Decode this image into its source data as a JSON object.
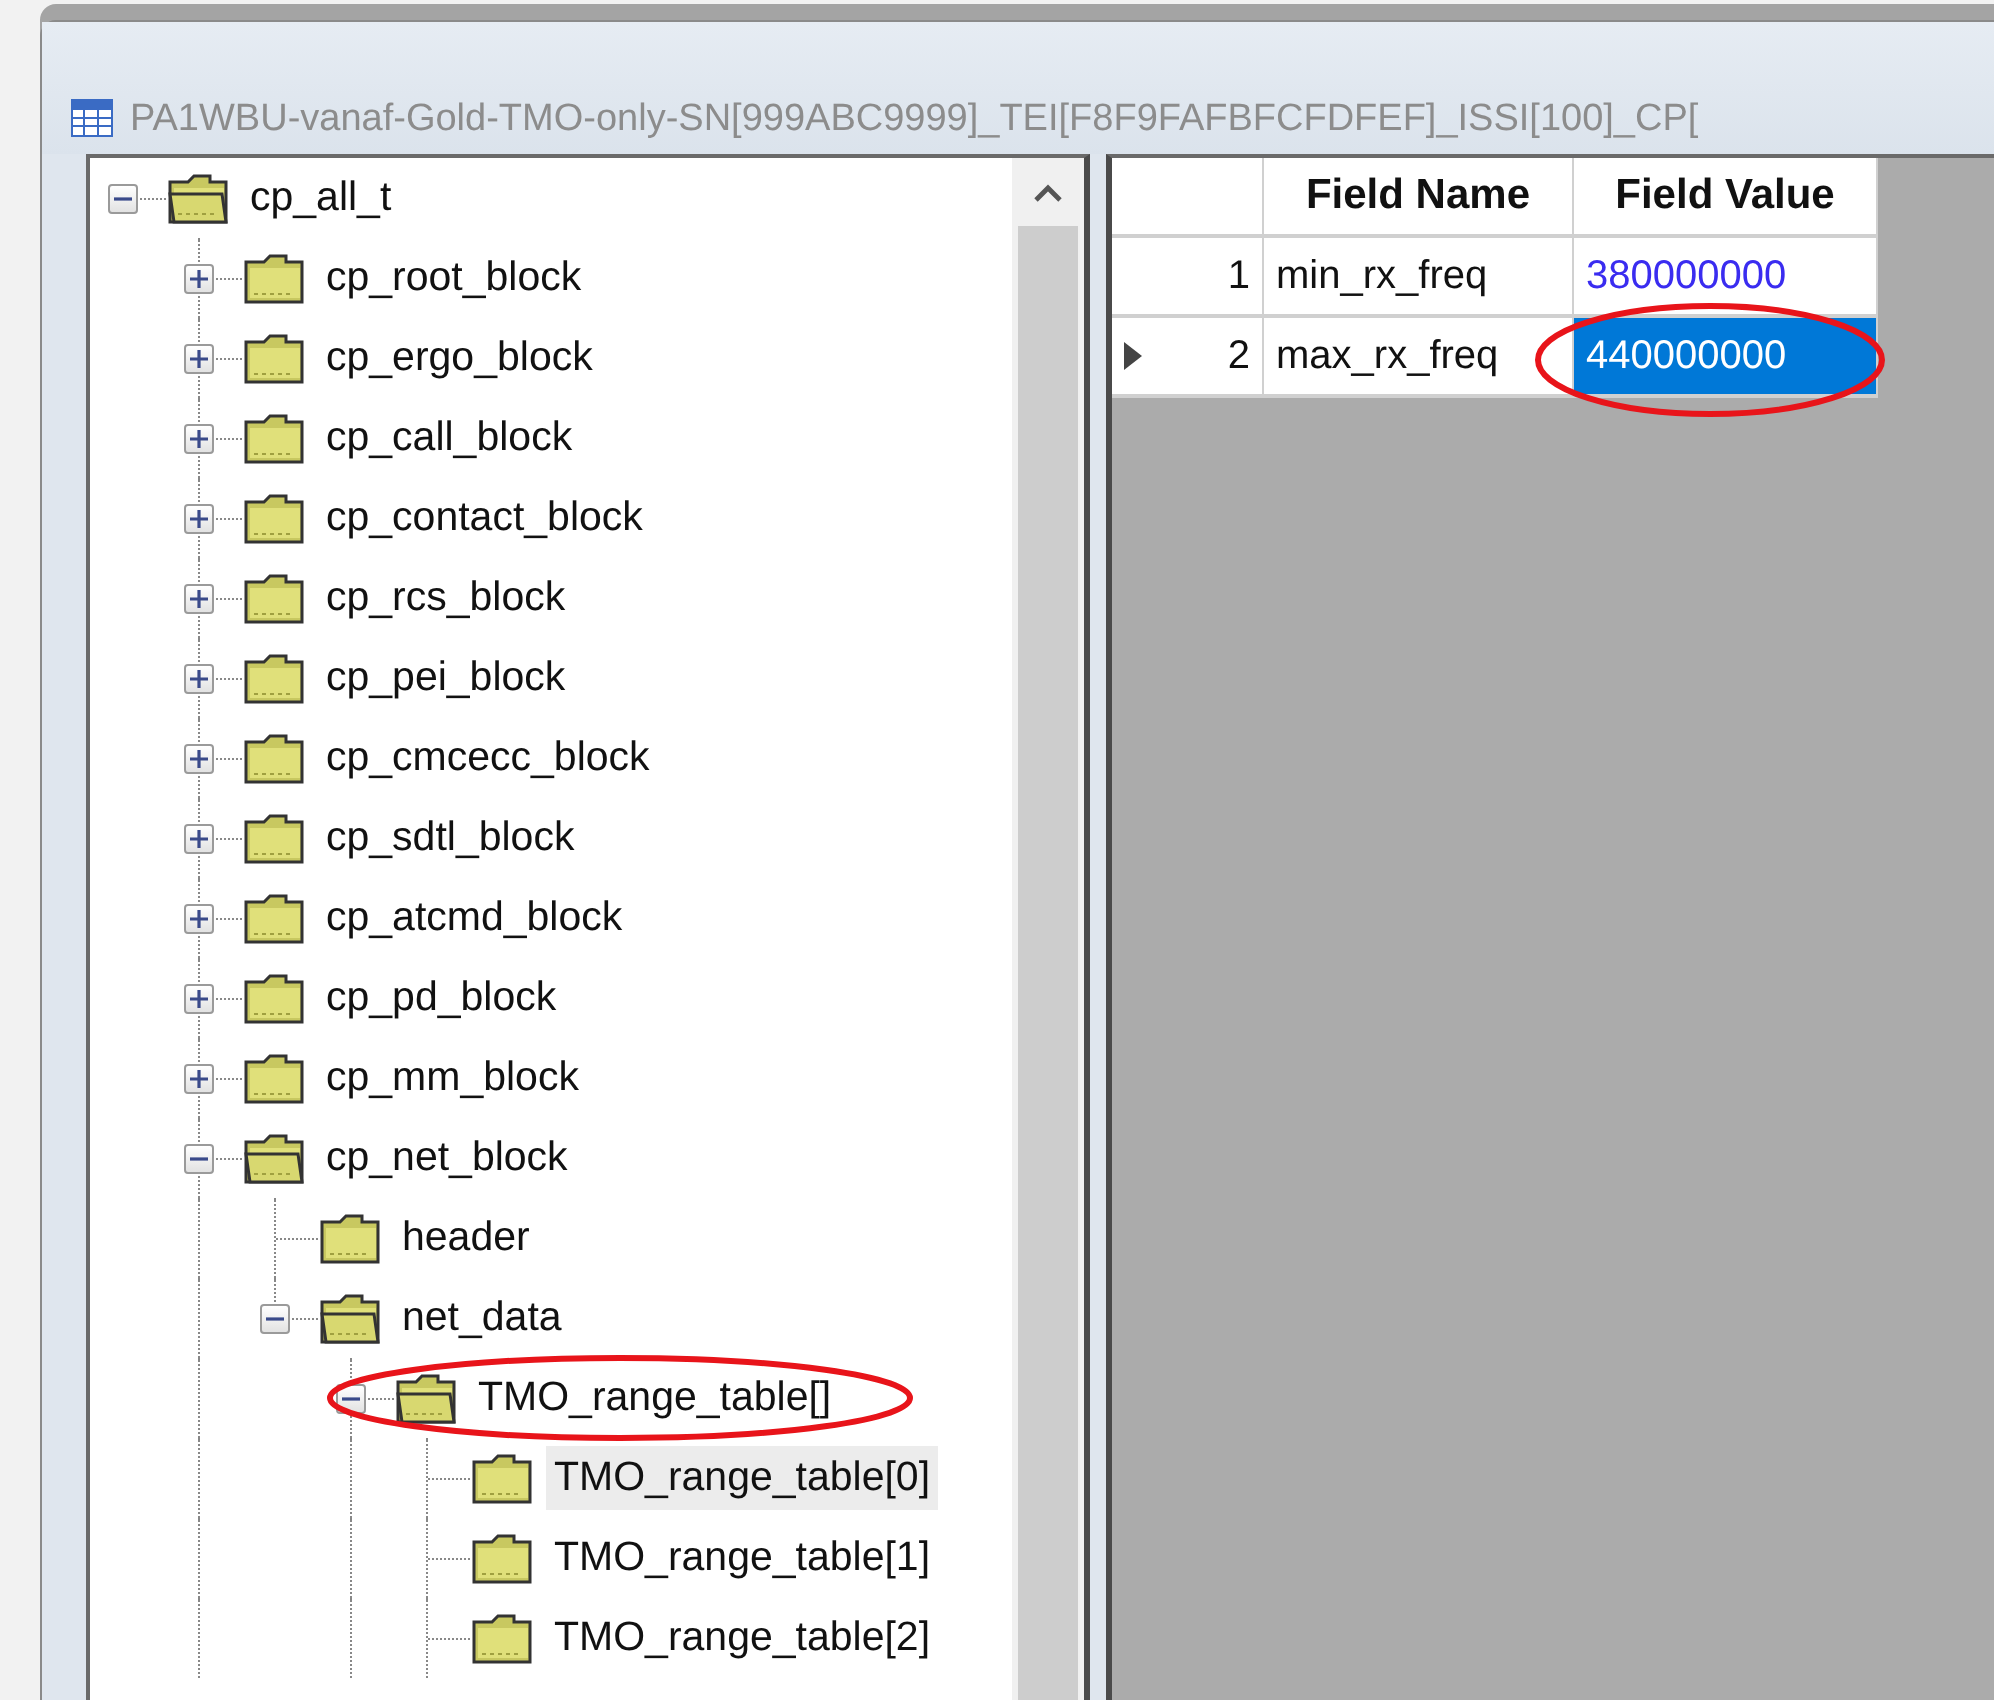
{
  "window": {
    "title": "PA1WBU-vanaf-Gold-TMO-only-SN[999ABC9999]_TEI[F8F9FAFBFCFDFEF]_ISSI[100]_CP["
  },
  "tree": [
    {
      "label": "cp_all_t",
      "expanded": true,
      "selected": false,
      "children": [
        {
          "label": "cp_root_block",
          "expanded": false,
          "selected": false
        },
        {
          "label": "cp_ergo_block",
          "expanded": false,
          "selected": false
        },
        {
          "label": "cp_call_block",
          "expanded": false,
          "selected": false
        },
        {
          "label": "cp_contact_block",
          "expanded": false,
          "selected": false
        },
        {
          "label": "cp_rcs_block",
          "expanded": false,
          "selected": false
        },
        {
          "label": "cp_pei_block",
          "expanded": false,
          "selected": false
        },
        {
          "label": "cp_cmcecc_block",
          "expanded": false,
          "selected": false
        },
        {
          "label": "cp_sdtl_block",
          "expanded": false,
          "selected": false
        },
        {
          "label": "cp_atcmd_block",
          "expanded": false,
          "selected": false
        },
        {
          "label": "cp_pd_block",
          "expanded": false,
          "selected": false
        },
        {
          "label": "cp_mm_block",
          "expanded": false,
          "selected": false
        },
        {
          "label": "cp_net_block",
          "expanded": true,
          "selected": false,
          "truncated": true,
          "children": [
            {
              "label": "header",
              "selected": false
            },
            {
              "label": "net_data",
              "expanded": true,
              "selected": false,
              "children": [
                {
                  "label": "TMO_range_table[]",
                  "expanded": true,
                  "selected": false,
                  "circled": true,
                  "truncated": true,
                  "children": [
                    {
                      "label": "TMO_range_table[0]",
                      "selected": true
                    },
                    {
                      "label": "TMO_range_table[1]",
                      "selected": false
                    },
                    {
                      "label": "TMO_range_table[2]",
                      "selected": false,
                      "truncated": true
                    }
                  ]
                }
              ]
            }
          ]
        }
      ]
    }
  ],
  "grid": {
    "columns": [
      "Field Name",
      "Field Value"
    ],
    "rows": [
      {
        "number": "1",
        "current": false,
        "name": "min_rx_freq",
        "value": "380000000",
        "value_selected": false,
        "circled": false
      },
      {
        "number": "2",
        "current": true,
        "name": "max_rx_freq",
        "value": "440000000",
        "value_selected": true,
        "circled": true
      }
    ]
  }
}
